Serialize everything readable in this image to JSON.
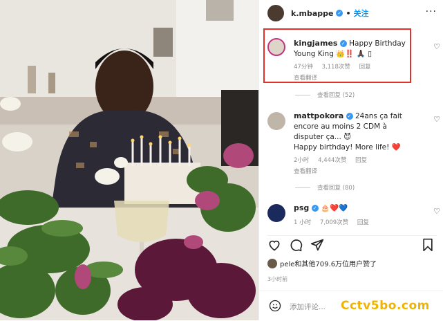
{
  "post": {
    "author": "k.mbappe",
    "follow_label": "关注",
    "more_label": "···"
  },
  "comments": [
    {
      "user": "kingjames",
      "text": "Happy Birthday Young King 👑‼️ 🙏🏿 ▯",
      "time": "47分钟",
      "likes": "3,118次赞",
      "reply": "回复",
      "translate": "查看翻译",
      "view_replies": "查看回复 (52)"
    },
    {
      "user": "mattpokora",
      "text_line1": "24ans ça fait encore au moins 2 CDM à disputer ça... 😈",
      "text_line2": "Happy birthday! More life! ❤️",
      "time": "2小时",
      "likes": "4,444次赞",
      "reply": "回复",
      "translate": "查看翻译",
      "view_replies": "查看回复 (80)"
    },
    {
      "user": "psg",
      "text": "🎂❤️💙",
      "time": "1 小时",
      "likes": "7,009次赞",
      "reply": "回复"
    }
  ],
  "likes_summary": "pele和其他709.6万位用户赞了",
  "post_time": "3小时前",
  "add_comment_placeholder": "添加评论...",
  "watermark": "Cctv5bo.com",
  "colors": {
    "accent": "#0095f6",
    "highlight_box": "#e0322b",
    "watermark": "#f0b400"
  },
  "icons": [
    "heart-icon",
    "comment-icon",
    "share-icon",
    "bookmark-icon",
    "emoji-icon",
    "more-icon",
    "verified-icon"
  ]
}
